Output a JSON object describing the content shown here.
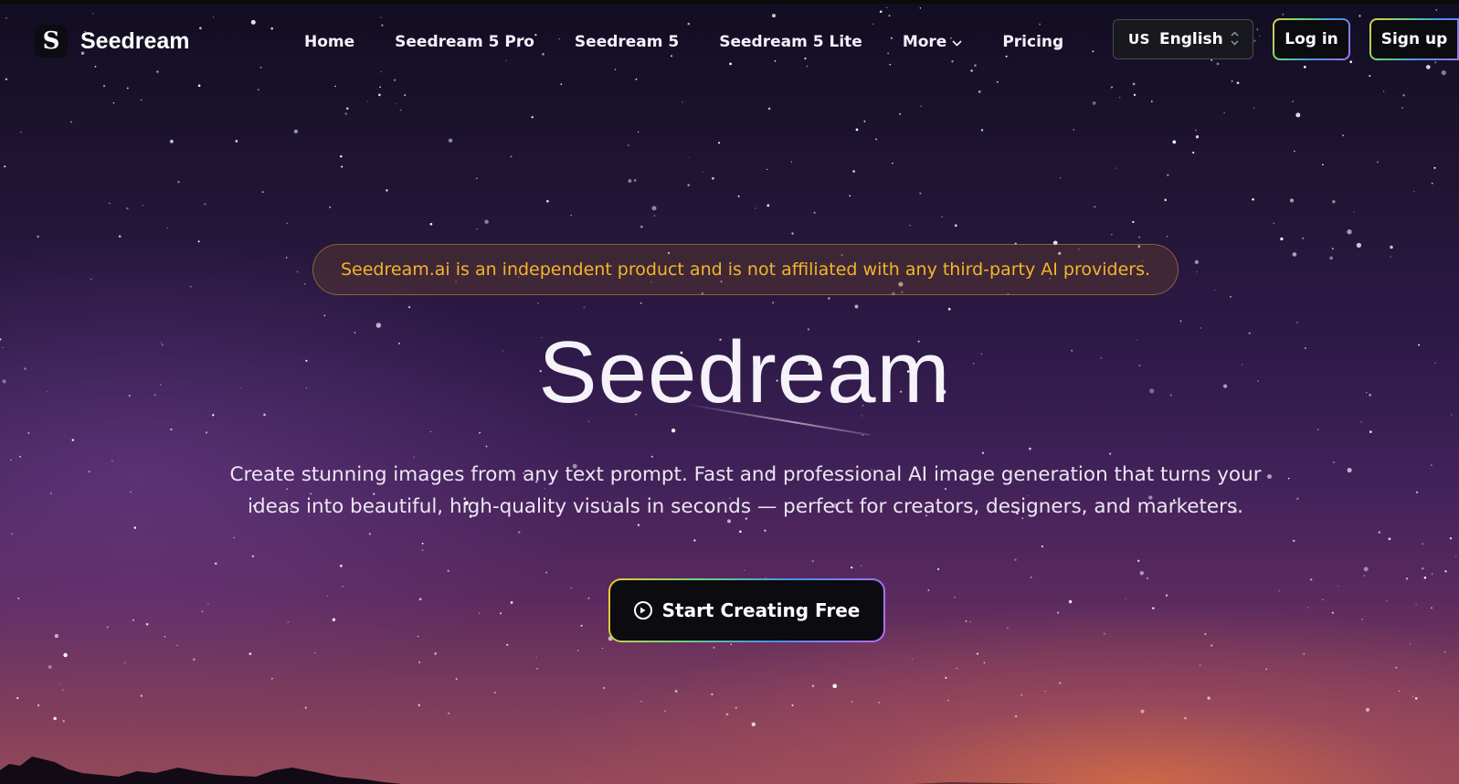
{
  "brand": {
    "logo_letter": "S",
    "name": "Seedream"
  },
  "nav": {
    "links": [
      {
        "label": "Home"
      },
      {
        "label": "Seedream 5 Pro"
      },
      {
        "label": "Seedream 5"
      },
      {
        "label": "Seedream 5 Lite"
      },
      {
        "label": "More",
        "icon": "chevron-down-icon"
      },
      {
        "label": "Pricing"
      }
    ],
    "language": {
      "flag": "US",
      "label": "English",
      "icon": "chevron-up-down-icon"
    },
    "login_label": "Log in",
    "signup_label": "Sign up"
  },
  "hero": {
    "notice": "Seedream.ai is an independent product and is not affiliated with any third-party AI providers.",
    "title": "Seedream",
    "description": "Create stunning images from any text prompt. Fast and professional AI image generation that turns your ideas into beautiful, high-quality visuals in seconds — perfect for creators, designers, and marketers.",
    "cta_label": "Start Creating Free",
    "cta_icon": "play-circle-icon"
  },
  "colors": {
    "notice_text": "#f2b52c",
    "button_bg": "#0b0b10",
    "gradient_border": [
      "#e8d140",
      "#5bd08a",
      "#4a8ff0",
      "#b06cf0"
    ]
  }
}
